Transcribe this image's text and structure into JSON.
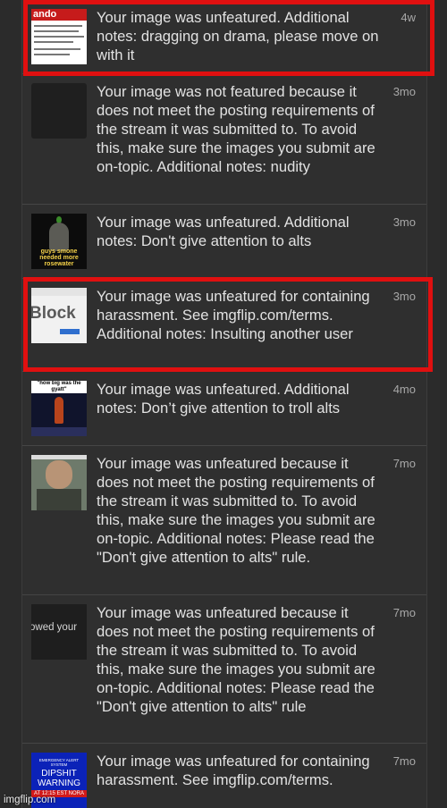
{
  "notifications": [
    {
      "message": "Your image was unfeatured. Additional notes: dragging on drama, please move on with it",
      "time": "4w",
      "thumb_text": "ando"
    },
    {
      "message": "Your image was not featured because it does not meet the posting requirements of the stream it was submitted to. To avoid this, make sure the images you submit are on-topic. Additional notes: nudity",
      "time": "3mo"
    },
    {
      "message": "Your image was unfeatured. Additional notes: Don't give attention to alts",
      "time": "3mo",
      "thumb_text": "guys smone needed more rosewater"
    },
    {
      "message": "Your image was unfeatured for containing harassment. See imgflip.com/terms. Additional notes: Insulting another user",
      "time": "3mo",
      "thumb_text": "Block"
    },
    {
      "message": "Your image was unfeatured. Additional notes: Don’t give attention to troll alts",
      "time": "4mo",
      "thumb_text": "\"how big was the gyatt\""
    },
    {
      "message": "Your image was unfeatured because it does not meet the posting requirements of the stream it was submitted to. To avoid this, make sure the images you submit are on-topic. Additional notes: Please read the \"Don't give attention to alts\" rule.",
      "time": "7mo"
    },
    {
      "message": "Your image was unfeatured because it does not meet the posting requirements of the stream it was submitted to. To avoid this, make sure the images you submit are on-topic. Additional notes: Please read the \"Don't give attention to alts\" rule",
      "time": "7mo",
      "thumb_text": "owed your"
    },
    {
      "message": "Your image was unfeatured for containing harassment. See imgflip.com/terms.",
      "time": "7mo",
      "thumb_text_top": "EMERGENCY ALERT SYSTEM",
      "thumb_text": "DIPSHIT WARNING",
      "thumb_text_bottom": "AT 12:15 EST NORA"
    }
  ],
  "watermark": "imgflip.com",
  "colors": {
    "highlight": "#e01010",
    "background": "#2b2b2b",
    "card": "#2f2f2f",
    "text": "#e2e2e2",
    "time": "#a8a8a8"
  }
}
